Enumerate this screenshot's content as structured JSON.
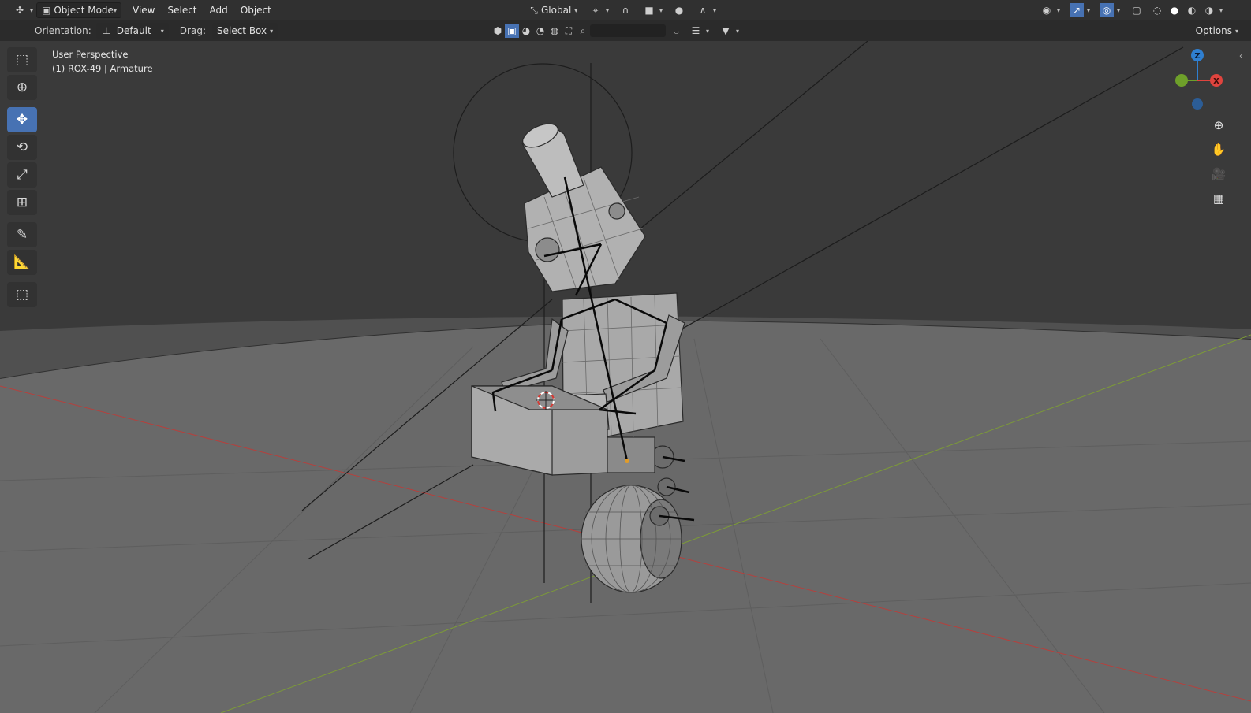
{
  "header": {
    "editor_type_icon": "editor-type-icon",
    "mode_label": "Object Mode",
    "menus": [
      "View",
      "Select",
      "Add",
      "Object"
    ],
    "transform_orientation": "Global",
    "options_label": "Options"
  },
  "tool_settings": {
    "orientation_label": "Orientation:",
    "orientation_value": "Default",
    "drag_label": "Drag:",
    "drag_value": "Select Box"
  },
  "viewport": {
    "view_name": "User Perspective",
    "active_object": "(1) ROX-49 | Armature"
  },
  "gizmo": {
    "axes": [
      "X",
      "Y",
      "Z"
    ],
    "x_color": "#e0443e",
    "y_color": "#6ea02a",
    "z_color": "#2f7fd0"
  },
  "toolbar": {
    "tools": [
      "select-box",
      "cursor",
      "move",
      "rotate",
      "scale",
      "transform",
      "annotate",
      "measure",
      "add-cube"
    ],
    "active_tool": "move"
  },
  "colors": {
    "accent": "#4772b3",
    "header_bg": "#303030",
    "grid_floor": "#6a6a6a",
    "wall": "#3a3a3a"
  }
}
